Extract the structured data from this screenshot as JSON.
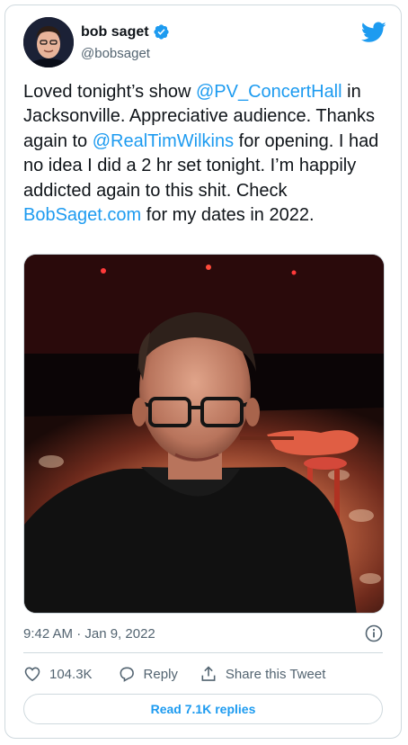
{
  "author": {
    "display_name": "bob saget",
    "handle": "@bobsaget",
    "verified": true
  },
  "tweet": {
    "parts": [
      {
        "text": "Loved tonight’s show ",
        "type": "text"
      },
      {
        "text": "@PV_ConcertHall",
        "type": "mention"
      },
      {
        "text": " in Jacksonville. Appreciative audience. Thanks again to ",
        "type": "text"
      },
      {
        "text": "@RealTimWilkins",
        "type": "mention"
      },
      {
        "text": " for opening. I had no idea I did a 2 hr set tonight. I’m happily addicted again to this shit. Check ",
        "type": "text"
      },
      {
        "text": "BobSaget.com",
        "type": "link"
      },
      {
        "text": " for my dates in 2022.",
        "type": "text"
      }
    ],
    "timestamp": "9:42 AM · Jan 9, 2022"
  },
  "actions": {
    "like_count": "104.3K",
    "reply_label": "Reply",
    "share_label": "Share this Tweet"
  },
  "read_replies_label": "Read 7.1K replies",
  "icons": {
    "brand": "twitter-bird-icon",
    "verified": "verified-badge-icon",
    "info": "info-icon",
    "like": "heart-icon",
    "reply": "speech-bubble-icon",
    "share": "share-upload-icon"
  },
  "colors": {
    "accent": "#1d9bf0",
    "text": "#0f1419",
    "secondary": "#536471",
    "border": "#cfd9de"
  }
}
